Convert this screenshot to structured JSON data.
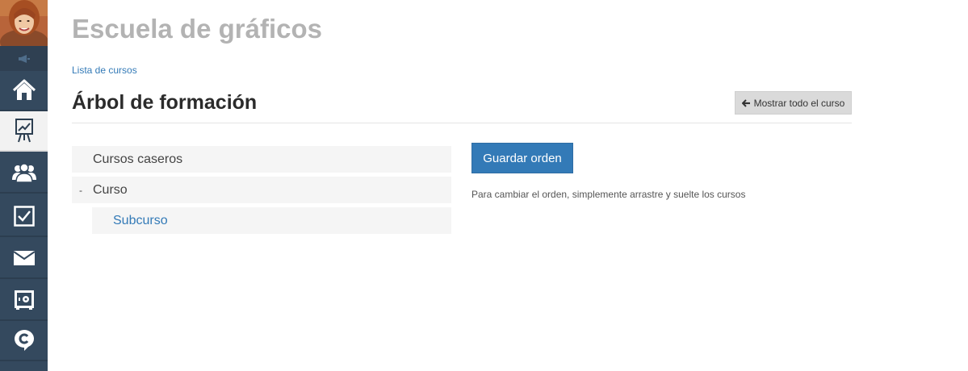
{
  "header": {
    "site_title": "Escuela de gráficos"
  },
  "breadcrumb": {
    "label": "Lista de cursos"
  },
  "page": {
    "title": "Árbol de formación",
    "show_all_label": "Mostrar todo el curso"
  },
  "tree": {
    "items": [
      {
        "label": "Cursos caseros"
      },
      {
        "label": "Curso",
        "toggle": "-"
      },
      {
        "label": "Subcurso"
      }
    ]
  },
  "actions": {
    "save_label": "Guardar orden",
    "help_text": "Para cambiar el orden, simplemente arrastre y suelte los cursos"
  },
  "sidebar": {
    "items": [
      {
        "icon": "home-icon"
      },
      {
        "icon": "chart-board-icon",
        "active": true
      },
      {
        "icon": "users-icon"
      },
      {
        "icon": "checkbox-icon"
      },
      {
        "icon": "mail-icon"
      },
      {
        "icon": "safe-icon"
      },
      {
        "icon": "chat-c-icon"
      }
    ]
  },
  "colors": {
    "sidebar_bg": "#34495e",
    "accent": "#337ab7",
    "title_gray": "#b3b3b3"
  }
}
